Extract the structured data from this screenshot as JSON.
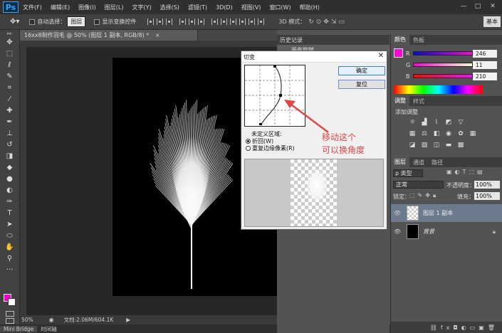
{
  "menubar": {
    "logo": "Ps",
    "items": [
      "文件(F)",
      "编辑(E)",
      "图像(I)",
      "图层(L)",
      "文字(Y)",
      "选择(S)",
      "滤镜(T)",
      "3D(D)",
      "视图(V)",
      "窗口(W)",
      "帮助(H)"
    ],
    "window_buttons": [
      "—",
      "□",
      "✕"
    ]
  },
  "options_bar": {
    "auto_select_label": "自动选择：",
    "auto_select_value": "图层",
    "show_transform_label": "显示变换控件",
    "mode_3d_label": "3D 模式：",
    "workspace_label": "基本"
  },
  "document": {
    "tab_title": "16xx8制作羽毛 @ 50% (图层 1 副本, RGB/8) *",
    "tab_close": "×",
    "zoom": "50%",
    "doc_size": "文档:2.06M/604.1K"
  },
  "bottom_tabs": [
    "Mini Bridge",
    "时间轴"
  ],
  "history_panel": {
    "title": "历史记录",
    "current_item": "画布旋转"
  },
  "color_panel": {
    "tabs": [
      "颜色",
      "色板"
    ],
    "r_label": "R",
    "g_label": "G",
    "b_label": "B",
    "r_value": "246",
    "g_value": "11",
    "b_value": "210",
    "foreground_color": "#f60bd2"
  },
  "adjustments_panel": {
    "tabs": [
      "调整",
      "样式"
    ],
    "add_label": "添加调整"
  },
  "layers_panel": {
    "tabs": [
      "图层",
      "通道",
      "路径"
    ],
    "filter_label": "ρ 类型",
    "blend_mode": "正常",
    "opacity_label": "不透明度：",
    "opacity_value": "100%",
    "lock_label": "锁定：",
    "fill_label": "填充：",
    "fill_value": "100%",
    "layers": [
      {
        "name": "图层 1 副本",
        "selected": true
      },
      {
        "name": "背景",
        "selected": false
      }
    ]
  },
  "shear_dialog": {
    "title": "切变",
    "ok_label": "确定",
    "reset_label": "复位",
    "undefined_area_label": "未定义区域:",
    "option_wrap": "折回(W)",
    "option_repeat": "重复边缘像素(R)"
  },
  "annotation": {
    "line1": "移动这个",
    "line2": "可以换角度",
    "color": "#e34545"
  }
}
